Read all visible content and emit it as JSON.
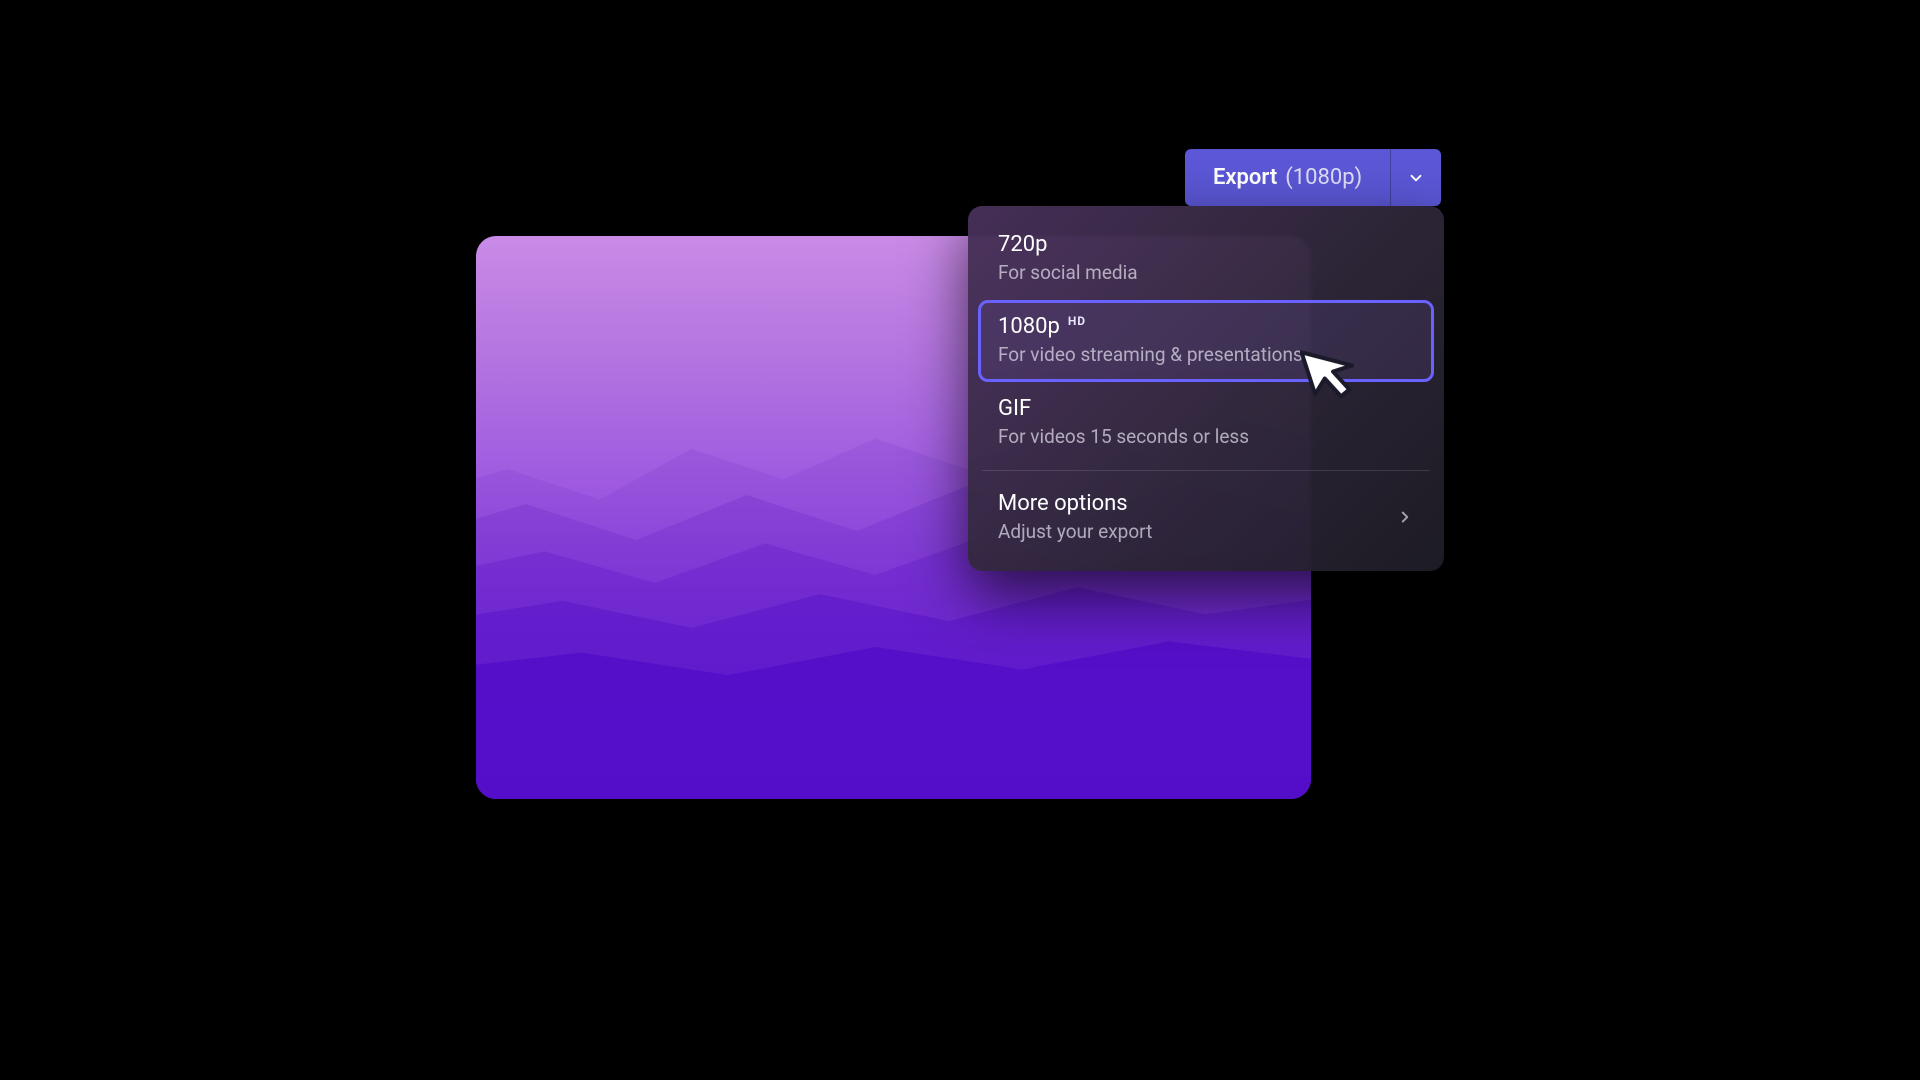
{
  "export_button": {
    "label": "Export",
    "resolution": "(1080p)"
  },
  "dropdown": {
    "items": [
      {
        "title": "720p",
        "subtitle": "For social media",
        "badge": "",
        "selected": false
      },
      {
        "title": "1080p",
        "subtitle": "For video streaming & presentations",
        "badge": "HD",
        "selected": true
      },
      {
        "title": "GIF",
        "subtitle": "For videos 15 seconds or less",
        "badge": "",
        "selected": false
      }
    ],
    "more": {
      "title": "More options",
      "subtitle": "Adjust your export"
    }
  }
}
